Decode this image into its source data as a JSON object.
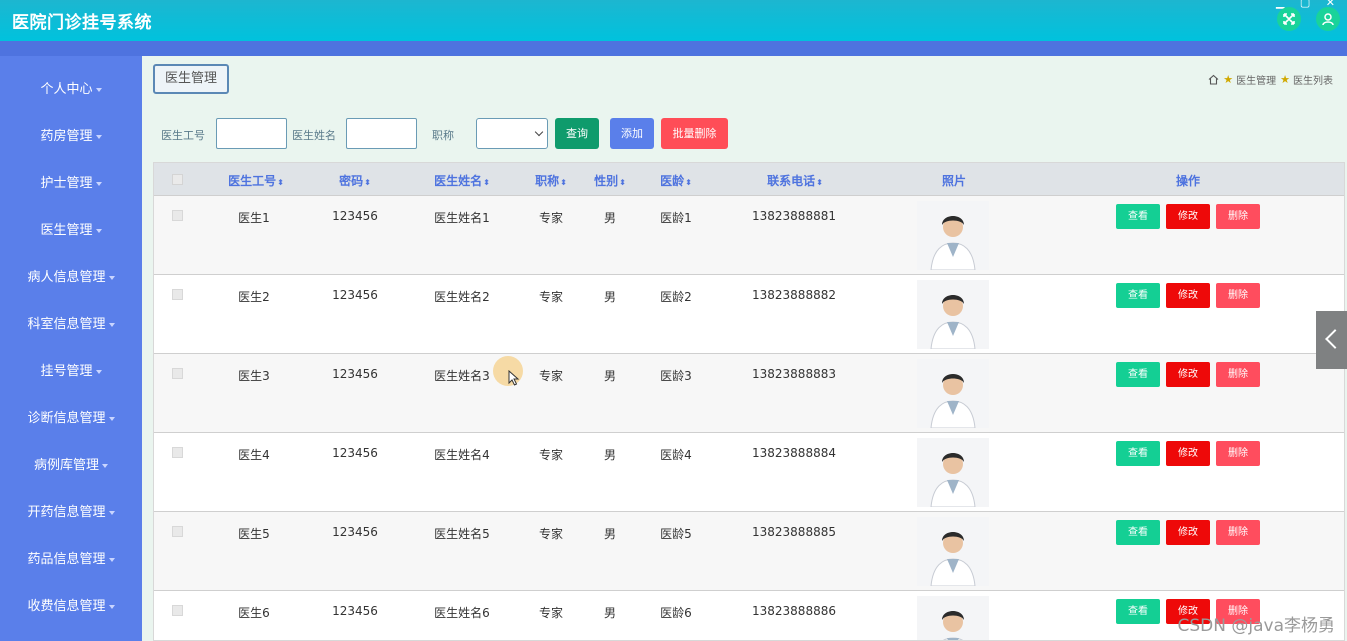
{
  "app": {
    "title": "医院门诊挂号系统"
  },
  "sidebar": {
    "items": [
      {
        "label": "个人中心"
      },
      {
        "label": "药房管理"
      },
      {
        "label": "护士管理"
      },
      {
        "label": "医生管理"
      },
      {
        "label": "病人信息管理"
      },
      {
        "label": "科室信息管理"
      },
      {
        "label": "挂号管理"
      },
      {
        "label": "诊断信息管理"
      },
      {
        "label": "病例库管理"
      },
      {
        "label": "开药信息管理"
      },
      {
        "label": "药品信息管理"
      },
      {
        "label": "收费信息管理"
      }
    ]
  },
  "tab": {
    "label": "医生管理"
  },
  "breadcrumb": {
    "level1": "医生管理",
    "level2": "医生列表"
  },
  "search": {
    "doctor_id_label": "医生工号",
    "doctor_name_label": "医生姓名",
    "title_label": "职称",
    "query_button": "查询",
    "add_button": "添加",
    "bulk_delete_button": "批量删除"
  },
  "table": {
    "headers": {
      "doctor_id": "医生工号",
      "password": "密码",
      "doctor_name": "医生姓名",
      "title": "职称",
      "gender": "性别",
      "seniority": "医龄",
      "phone": "联系电话",
      "photo": "照片",
      "actions": "操作"
    },
    "sort_glyph": "⬍",
    "action_labels": {
      "view": "查看",
      "edit": "修改",
      "delete": "删除"
    },
    "rows": [
      {
        "doctor_id": "医生1",
        "password": "123456",
        "doctor_name": "医生姓名1",
        "title": "专家",
        "gender": "男",
        "seniority": "医龄1",
        "phone": "13823888881"
      },
      {
        "doctor_id": "医生2",
        "password": "123456",
        "doctor_name": "医生姓名2",
        "title": "专家",
        "gender": "男",
        "seniority": "医龄2",
        "phone": "13823888882"
      },
      {
        "doctor_id": "医生3",
        "password": "123456",
        "doctor_name": "医生姓名3",
        "title": "专家",
        "gender": "男",
        "seniority": "医龄3",
        "phone": "13823888883"
      },
      {
        "doctor_id": "医生4",
        "password": "123456",
        "doctor_name": "医生姓名4",
        "title": "专家",
        "gender": "男",
        "seniority": "医龄4",
        "phone": "13823888884"
      },
      {
        "doctor_id": "医生5",
        "password": "123456",
        "doctor_name": "医生姓名5",
        "title": "专家",
        "gender": "男",
        "seniority": "医龄5",
        "phone": "13823888885"
      },
      {
        "doctor_id": "医生6",
        "password": "123456",
        "doctor_name": "医生姓名6",
        "title": "专家",
        "gender": "男",
        "seniority": "医龄6",
        "phone": "13823888886"
      }
    ]
  },
  "watermark": "CSDN @java李杨勇",
  "colors": {
    "header": "#00c2dd",
    "sidebar": "#5a7fea",
    "view_button": "#14cf94",
    "edit_button": "#ee0909",
    "delete_button": "#ff4d5e"
  }
}
